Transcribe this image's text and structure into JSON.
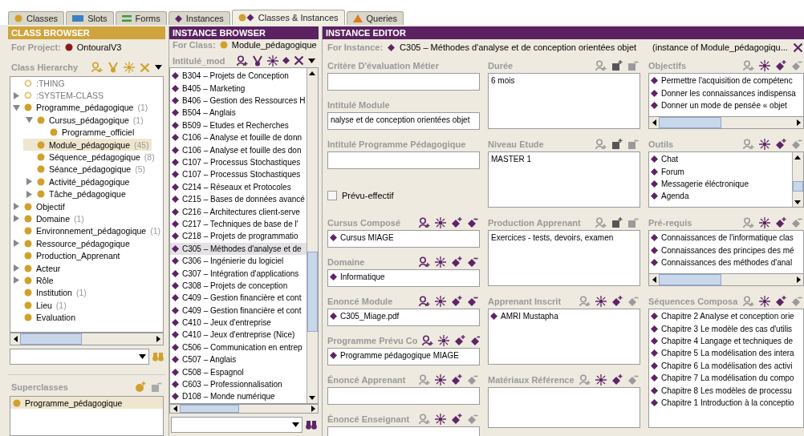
{
  "tabs": [
    {
      "label": "Classes",
      "kind": "class",
      "selected": false
    },
    {
      "label": "Slots",
      "kind": "slot",
      "selected": false
    },
    {
      "label": "Forms",
      "kind": "form",
      "selected": false
    },
    {
      "label": "Instances",
      "kind": "instance",
      "selected": false
    },
    {
      "label": "Classes & Instances",
      "kind": "both",
      "selected": true
    },
    {
      "label": "Queries",
      "kind": "query",
      "selected": false
    }
  ],
  "class_browser": {
    "title": "CLASS BROWSER",
    "project_label": "For Project:",
    "project": "OntouralV3",
    "hierarchy_label": "Class Hierarchy",
    "tree": [
      {
        "name": ":THING",
        "kind": "system",
        "selected": false
      },
      {
        "name": ":SYSTEM-CLASS",
        "kind": "system",
        "expanded": false,
        "selected": false
      },
      {
        "name": "Programme_pédagogique",
        "count": "(1)",
        "kind": "class",
        "expanded": true,
        "selected": false,
        "children": [
          {
            "name": "Cursus_pédagogique",
            "count": "(1)",
            "kind": "class",
            "expanded": true,
            "selected": false,
            "children": [
              {
                "name": "Programme_officiel",
                "kind": "class",
                "selected": false
              }
            ]
          },
          {
            "name": "Module_pédagogique",
            "count": "(45)",
            "kind": "class",
            "selected": true
          },
          {
            "name": "Séquence_pédagogique",
            "count": "(8)",
            "kind": "class",
            "selected": false
          },
          {
            "name": "Séance_pédagogique",
            "count": "(5)",
            "kind": "class",
            "selected": false
          },
          {
            "name": "Activité_pédagogique",
            "kind": "class",
            "expanded": false,
            "selected": false
          },
          {
            "name": "Tâche_pédagogique",
            "kind": "class",
            "expanded": false,
            "selected": false
          }
        ]
      },
      {
        "name": "Objectif",
        "kind": "class",
        "expanded": false,
        "selected": false
      },
      {
        "name": "Domaine",
        "count": "(1)",
        "kind": "class",
        "expanded": false,
        "selected": false
      },
      {
        "name": "Environnement_pédagogique",
        "count": "(1)",
        "kind": "class",
        "selected": false
      },
      {
        "name": "Ressource_pédagogique",
        "kind": "class",
        "expanded": false,
        "selected": false
      },
      {
        "name": "Production_Apprenant",
        "kind": "class",
        "selected": false
      },
      {
        "name": "Acteur",
        "kind": "class",
        "expanded": false,
        "selected": false
      },
      {
        "name": "Rôle",
        "kind": "class",
        "expanded": false,
        "selected": false
      },
      {
        "name": "Institution",
        "count": "(1)",
        "kind": "class",
        "selected": false
      },
      {
        "name": "Lieu",
        "count": "(1)",
        "kind": "class",
        "selected": false
      },
      {
        "name": "Evaluation",
        "kind": "class",
        "selected": false
      }
    ],
    "superclasses_label": "Superclasses",
    "superclasses": [
      {
        "name": "Programme_pédagogique",
        "selected": true
      }
    ]
  },
  "instance_browser": {
    "title": "INSTANCE BROWSER",
    "class_label": "For Class:",
    "class": "Module_pédagogique",
    "column_label": "Intitulé_mod",
    "instances": [
      {
        "name": "B304 – Projets de Conception",
        "selected": false
      },
      {
        "name": "B405 – Marketing",
        "selected": false
      },
      {
        "name": "B406 – Gestion des Ressources H",
        "selected": false
      },
      {
        "name": "B504 – Anglais",
        "selected": false
      },
      {
        "name": "B509 – Etudes et Recherches",
        "selected": false
      },
      {
        "name": "C106 – Analyse et fouille de donn",
        "selected": false
      },
      {
        "name": "C106 – Analyse et fouille des don",
        "selected": false
      },
      {
        "name": "C107 – Processus Stochastiques",
        "selected": false
      },
      {
        "name": "C107 – Processus Stochastiques",
        "selected": false
      },
      {
        "name": "C214 – Réseaux et Protocoles",
        "selected": false
      },
      {
        "name": "C215 – Bases de données avancé",
        "selected": false
      },
      {
        "name": "C216 – Architectures client-serve",
        "selected": false
      },
      {
        "name": "C217 – Techniques de base de l'",
        "selected": false
      },
      {
        "name": "C218 – Projets de programmatio",
        "selected": false
      },
      {
        "name": "C305 – Méthodes d'analyse et de",
        "selected": true
      },
      {
        "name": "C306 – Ingénierie du logiciel",
        "selected": false
      },
      {
        "name": "C307 – Intégration d'applications",
        "selected": false
      },
      {
        "name": "C308 – Projets de conception",
        "selected": false
      },
      {
        "name": "C409 – Gestion financière et cont",
        "selected": false
      },
      {
        "name": "C409 – Gestion financière et cont",
        "selected": false
      },
      {
        "name": "C410 – Jeux d'entreprise",
        "selected": false
      },
      {
        "name": "C410 – Jeux d'entreprise (Nice)",
        "selected": false
      },
      {
        "name": "C506 – Communication en entrep",
        "selected": false
      },
      {
        "name": "C507 – Anglais",
        "selected": false
      },
      {
        "name": "C508 – Espagnol",
        "selected": false
      },
      {
        "name": "C603 – Professionnalisation",
        "selected": false
      },
      {
        "name": "D108 – Monde numérique",
        "selected": false
      }
    ]
  },
  "instance_editor": {
    "title": "INSTANCE EDITOR",
    "instance_label": "For Instance:",
    "instance": "C305 – Méthodes d'analyse et de conception orientées objet",
    "instance_of": "(instance of Module_pédagogiqu...",
    "columns": [
      [
        {
          "label": "Critère D'évaluation Métier",
          "kind": "text"
        },
        {
          "label": "Intitulé Module",
          "kind": "text",
          "value": "nalyse et de conception orientées objet"
        },
        {
          "label": "Intitulé Programme Pédagogique",
          "kind": "text"
        },
        {
          "label": "Prévu-effectif",
          "kind": "checkbox",
          "checked": false
        },
        {
          "label": "Cursus Composé",
          "kind": "instance",
          "remove_enabled": true,
          "items": [
            "Cursus MIAGE"
          ]
        },
        {
          "label": "Domaine",
          "kind": "instance",
          "remove_enabled": true,
          "items": [
            "Informatique"
          ]
        },
        {
          "label": "Enoncé Module",
          "kind": "instance",
          "remove_enabled": true,
          "items": [
            "C305_Miage.pdf"
          ]
        },
        {
          "label": "Programme Prévu Co",
          "kind": "instance",
          "remove_enabled": true,
          "items": [
            "Programme pédagogique MIAGE"
          ]
        },
        {
          "label": "Énoncé Apprenant",
          "kind": "instance",
          "remove_enabled": false
        },
        {
          "label": "Énoncé Enseignant",
          "kind": "instance",
          "remove_enabled": false
        }
      ],
      [
        {
          "label": "Durée",
          "kind": "values",
          "value": "6 mois"
        },
        {
          "label": "Niveau Etude",
          "kind": "values",
          "value": "MASTER 1"
        },
        {
          "label": "Production Apprenant",
          "kind": "values",
          "value": "Exercices - tests, devoirs, examen"
        },
        {
          "label": "Apprenant Inscrit",
          "kind": "instances",
          "remove_enabled": false,
          "items": [
            "AMRI Mustapha"
          ]
        },
        {
          "label": "Matériaux Référence",
          "kind": "instances",
          "remove_enabled": false
        }
      ],
      [
        {
          "label": "Objectifs",
          "kind": "instances",
          "remove_enabled": false,
          "items": [
            "Permettre l'acquisition de compétenc",
            "Donner les connaissances indispensa",
            "Donner un mode de pensée « objet"
          ]
        },
        {
          "label": "Outils",
          "kind": "instances",
          "remove_enabled": false,
          "items": [
            "Chat",
            "Forum",
            "Messagerie éléctronique",
            "Agenda"
          ]
        },
        {
          "label": "Pré-requis",
          "kind": "instances",
          "remove_enabled": false,
          "items": [
            "Connaissances de l'informatique clas",
            "Connaissances des principes des mé",
            "Connaissances des méthodes d'anal"
          ]
        },
        {
          "label": "Séquences Composa",
          "kind": "instances",
          "remove_enabled": false,
          "items": [
            "Chapitre 2 Analyse et conception orie",
            "Chapitre 3 Le modèle des cas d'utilis",
            "Chapitre 4 Langage et techniques de",
            "Chapitre 5 La modélisation des intera",
            "Chapitre 6 La modélisation des activi",
            "Chapitre 7 La modélisation du compo",
            "Chapitre 8 Les modèles de processu",
            "Chapitre 1 Introduction à la conceptio"
          ]
        }
      ]
    ]
  }
}
